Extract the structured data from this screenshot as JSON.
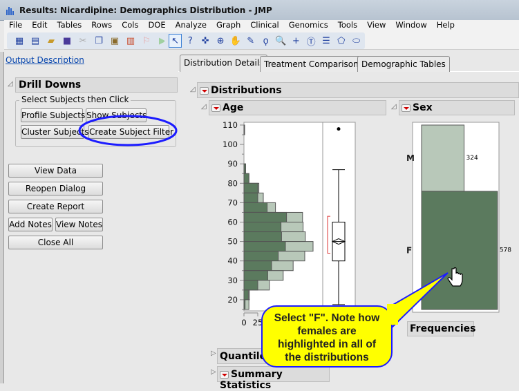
{
  "window": {
    "title": "Results: Nicardipine: Demographics Distribution - JMP"
  },
  "menu": [
    "File",
    "Edit",
    "Tables",
    "Rows",
    "Cols",
    "DOE",
    "Analyze",
    "Graph",
    "Clinical",
    "Genomics",
    "Tools",
    "View",
    "Window",
    "Help"
  ],
  "left": {
    "output_description": "Output Description",
    "drill_downs": "Drill Downs",
    "group_label": "Select Subjects then Click",
    "profile_subjects": "Profile Subjects",
    "show_subjects": "Show Subjects",
    "cluster_subjects": "Cluster Subjects",
    "create_subject_filter": "Create Subject Filter",
    "view_data": "View Data",
    "reopen_dialog": "Reopen Dialog",
    "create_report": "Create Report",
    "add_notes": "Add Notes",
    "view_notes": "View Notes",
    "close_all": "Close All"
  },
  "tabs": [
    "Distribution Details",
    "Treatment Comparisons",
    "Demographic Tables"
  ],
  "report": {
    "distributions": "Distributions",
    "age": "Age",
    "sex": "Sex",
    "frequencies": "Frequencies",
    "quantiles": "Quantiles",
    "summary_statistics": "Summary Statistics"
  },
  "callout": {
    "lines": [
      "Select \"F\". Note how",
      "females are",
      "highlighted in all of",
      "the distributions"
    ]
  },
  "colors": {
    "selected": "#5b7a5e",
    "unselected": "#b8c8b9",
    "callout": "#ffff00",
    "ellipse": "#1c1cff"
  },
  "chart_data": [
    {
      "type": "bar",
      "title": "Age",
      "orientation": "horizontal histogram",
      "bin_width": 5,
      "bins": [
        105,
        85,
        80,
        75,
        70,
        65,
        60,
        55,
        50,
        45,
        40,
        35,
        30,
        25,
        20,
        15
      ],
      "series": [
        {
          "name": "Total",
          "values": [
            1,
            3,
            9,
            27,
            35,
            57,
            106,
            107,
            111,
            125,
            110,
            89,
            71,
            46,
            10,
            9
          ]
        },
        {
          "name": "F (selected)",
          "values": [
            0,
            3,
            9,
            25,
            25,
            42,
            77,
            67,
            68,
            75,
            62,
            50,
            43,
            25,
            8,
            2
          ]
        }
      ],
      "yticks": [
        "110",
        "100",
        "90",
        "80",
        "70",
        "60",
        "50",
        "40",
        "30",
        "20"
      ],
      "ylim": [
        15,
        112
      ],
      "xticks": [
        "0",
        "25"
      ],
      "boxplot": {
        "min": 17.5,
        "q1": 40,
        "median": 50,
        "q3": 60,
        "max": 87,
        "mean": 50,
        "outliers": [
          108
        ],
        "shortest_half": [
          44,
          63
        ]
      }
    },
    {
      "type": "bar",
      "title": "Sex",
      "categories": [
        "M",
        "F"
      ],
      "values": [
        324,
        578
      ],
      "labels": [
        "324",
        "578"
      ],
      "selected": "F"
    }
  ]
}
